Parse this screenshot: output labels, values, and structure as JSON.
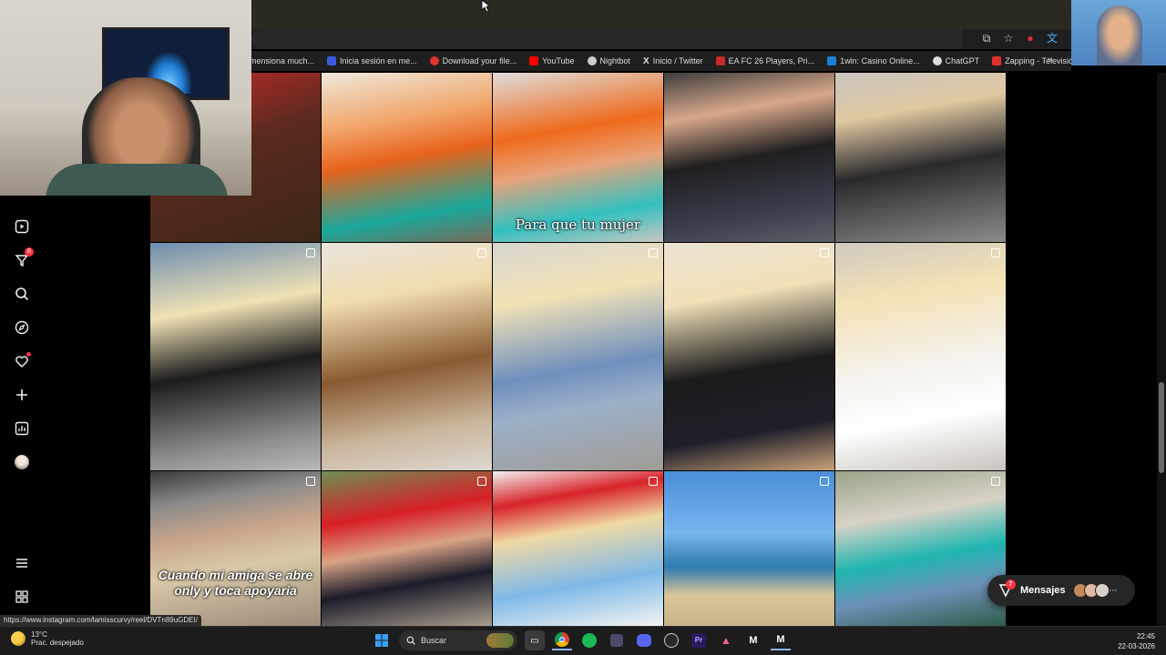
{
  "browser": {
    "bookmarks": [
      {
        "label": "mensiona much...",
        "color": "#444444"
      },
      {
        "label": "Inicia sesión en me...",
        "color": "#3b5bdb"
      },
      {
        "label": "Download your file...",
        "color": "#e03131"
      },
      {
        "label": "YouTube",
        "color": "#ff0000"
      },
      {
        "label": "Nightbot",
        "color": "#cccccc"
      },
      {
        "label": "Inicio / Twitter",
        "color": "#ffffff"
      },
      {
        "label": "EA FC 26 Players, Pri...",
        "color": "#c92a2a"
      },
      {
        "label": "1win: Casino Online...",
        "color": "#1c7ed6"
      },
      {
        "label": "ChatGPT",
        "color": "#dddddd"
      },
      {
        "label": "Zapping - Televisión...",
        "color": "#e03131"
      }
    ],
    "more_label": "»",
    "status_url": "https://www.instagram.com/lamisscurvy/reel/DVTn89uGDEI/"
  },
  "nav": {
    "badge_count": "8",
    "icons": [
      "reels-icon",
      "filter-icon",
      "search-icon",
      "compass-icon",
      "heart-icon",
      "plus-icon",
      "chart-icon",
      "avatar",
      "menu-icon",
      "apps-icon"
    ]
  },
  "grid": {
    "caption_row1": "Para que tu mujer",
    "caption_row3": "Cuando mi amiga se abre only y toca apoyaria"
  },
  "messages": {
    "label": "Mensajes",
    "badge": "7"
  },
  "taskbar": {
    "temperature": "13°C",
    "weather": "Prac. despejado",
    "search_label": "Buscar",
    "time": "22:45",
    "date": "22-03-2026"
  },
  "colors": {
    "accent": "#ff3040",
    "background": "#000000",
    "chrome": "#1f1f1f"
  }
}
